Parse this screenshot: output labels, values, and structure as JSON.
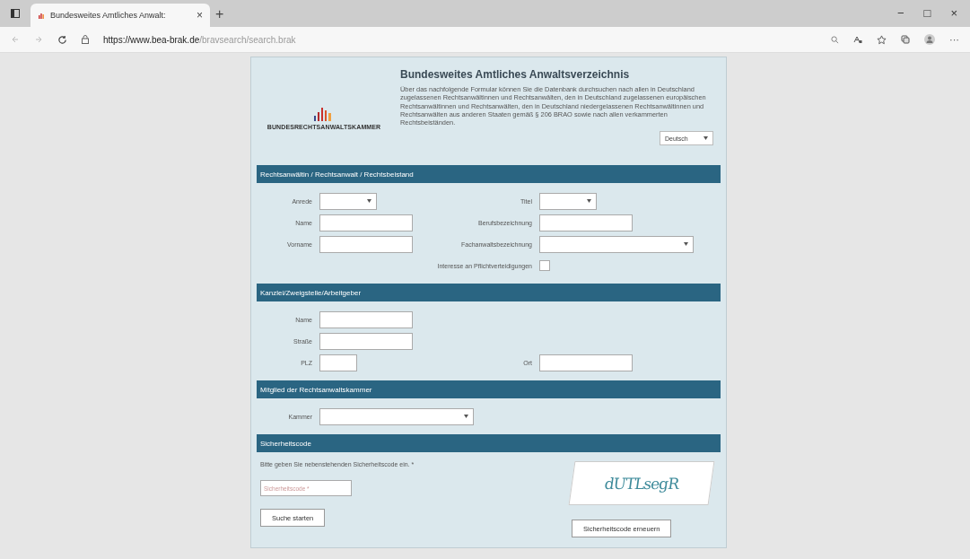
{
  "browser": {
    "tab_title": "Bundesweites Amtliches Anwalt:",
    "tab_close": "×",
    "new_tab": "+",
    "url_host": "https://www.bea-brak.de",
    "url_path": "/bravsearch/search.brak",
    "window_buttons": [
      "−",
      "□",
      "×"
    ],
    "more": "···"
  },
  "header": {
    "logo_text": "BUNDESRECHTSANWALTSKAMMER",
    "title": "Bundesweites Amtliches Anwaltsverzeichnis",
    "description": "Über das nachfolgende Formular können Sie die Datenbank durchsuchen nach allen in Deutschland zugelassenen Rechtsanwältinnen und Rechtsanwälten, den in Deutschland zugelassenen europäischen Rechtsanwältinnen und Rechtsanwälten, den in Deutschland niedergelassenen Rechtsanwältinnen und Rechtsanwälten aus anderen Staaten gemäß § 206 BRAO sowie nach allen verkammerten Rechtsbeiständen.",
    "language": "Deutsch"
  },
  "sections": [
    {
      "title": "Rechtsanwältin / Rechtsanwalt / Rechtsbeistand",
      "rows": [
        [
          {
            "label": "Anrede",
            "kind": "select"
          },
          {
            "label": "Titel",
            "kind": "select"
          }
        ],
        [
          {
            "label": "Name",
            "kind": "input"
          },
          {
            "label": "Berufsbezeichnung",
            "kind": "input"
          }
        ],
        [
          {
            "label": "Vorname",
            "kind": "input"
          },
          {
            "label": "Fachanwaltsbezeichnung",
            "kind": "wideselect"
          }
        ],
        [
          "",
          {
            "label": "Interesse an Pflichtverteidigungen",
            "kind": "checkbox",
            "checked": false
          }
        ]
      ]
    },
    {
      "title": "Kanzlei/Zweigstelle/Arbeitgeber",
      "rows": [
        [
          {
            "label": "Name",
            "kind": "input"
          }
        ],
        [
          {
            "label": "Straße",
            "kind": "input"
          }
        ],
        [
          {
            "label": "PLZ",
            "kind": "shortinput"
          },
          {
            "label": "Ort",
            "kind": "input"
          }
        ]
      ]
    },
    {
      "title": "Mitglied der Rechtsanwaltskammer",
      "rows": [
        [
          {
            "label": "Kammer",
            "kind": "wideselect"
          }
        ]
      ]
    }
  ],
  "security": {
    "title": "Sicherheitscode",
    "instruction": "Bitte geben Sie nebenstehenden Sicherheitscode ein. *",
    "placeholder": "Sicherheitscode *",
    "captcha_text": "dUTLsegR",
    "search_button": "Suche starten",
    "renew_button": "Sicherheitscode erneuern"
  }
}
